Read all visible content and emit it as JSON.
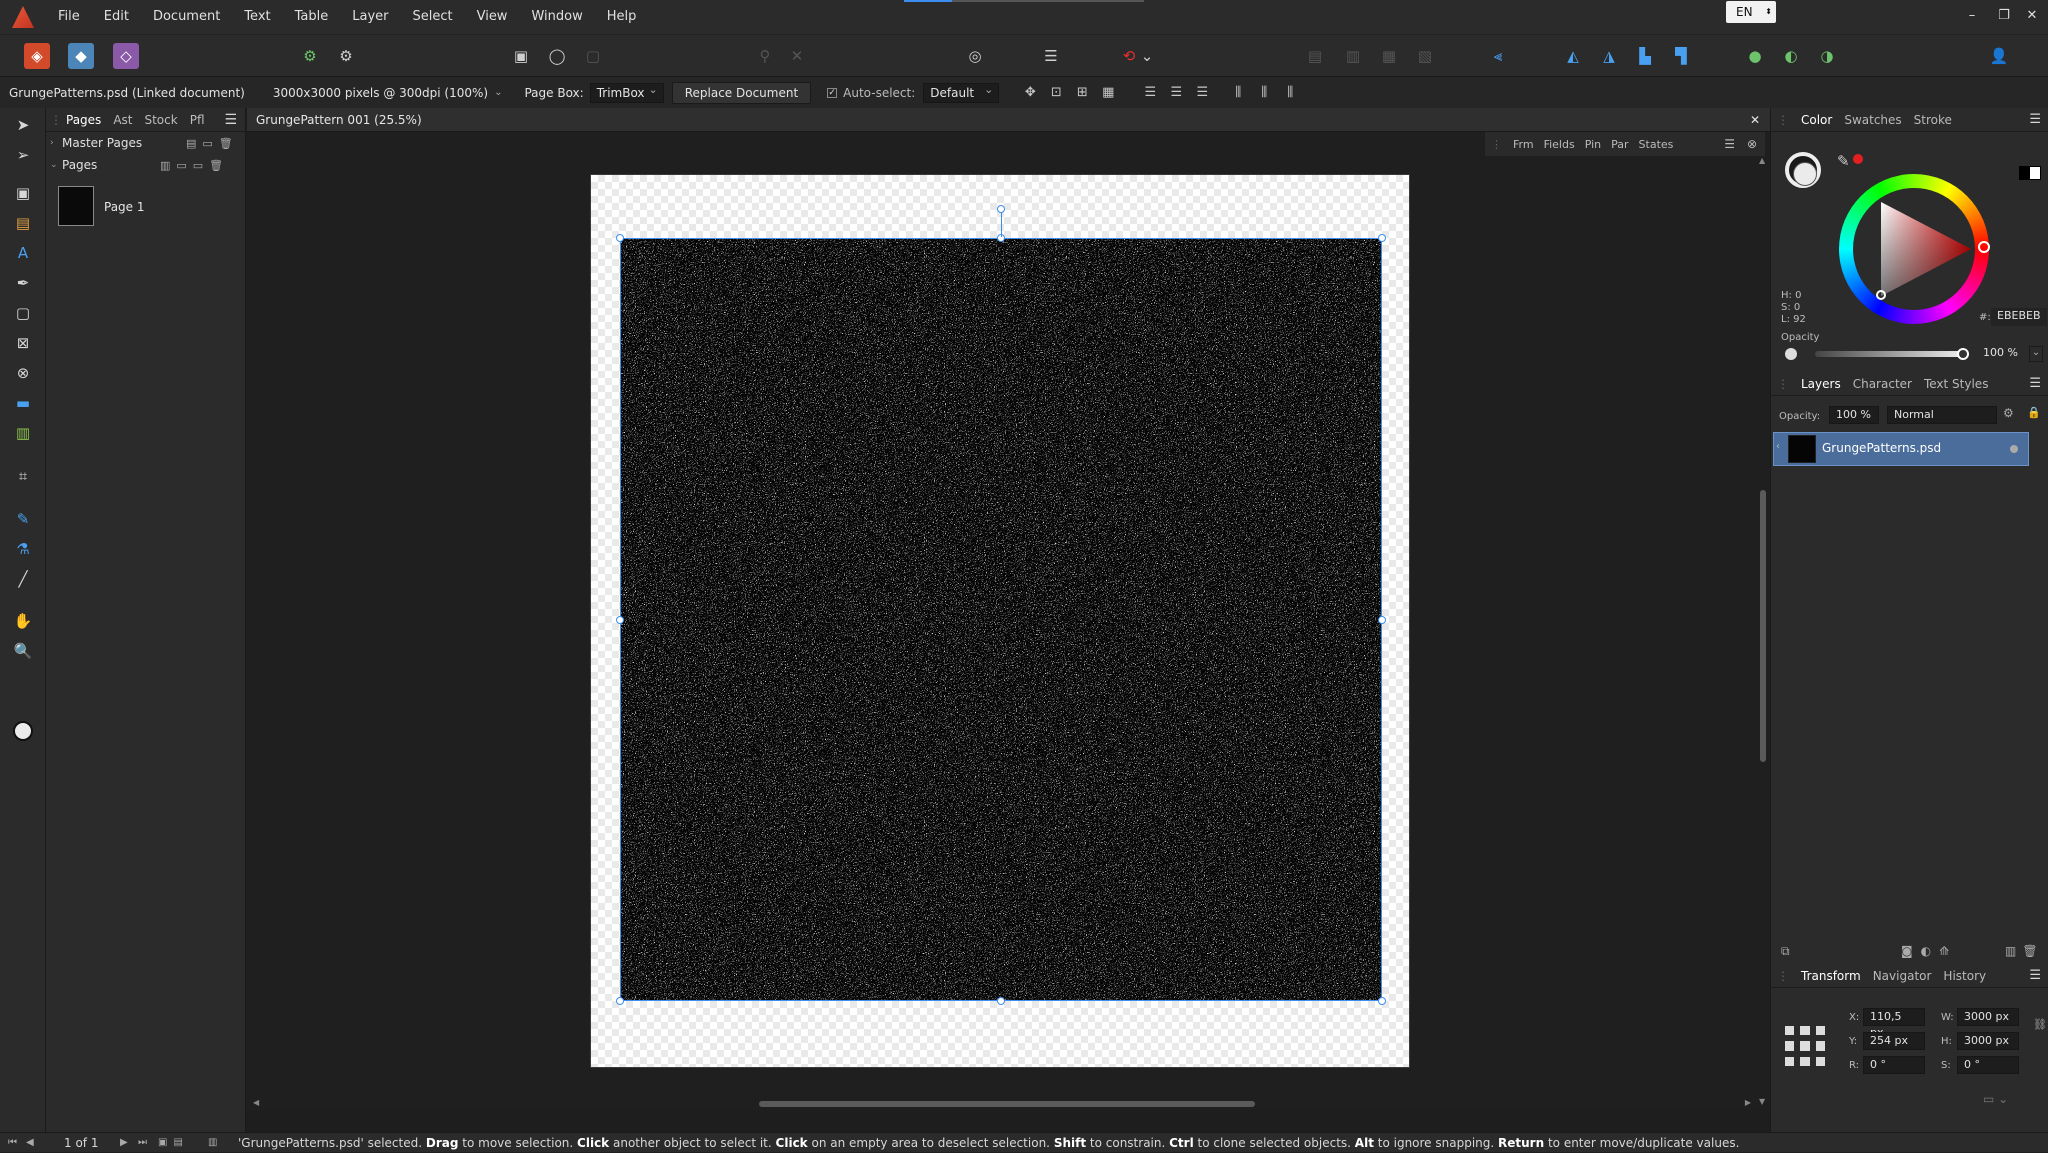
{
  "menubar": {
    "items": [
      "File",
      "Edit",
      "Document",
      "Text",
      "Table",
      "Layer",
      "Select",
      "View",
      "Window",
      "Help"
    ],
    "language": "EN"
  },
  "context": {
    "doc_name": "GrungePatterns.psd (Linked document)",
    "doc_info": "3000x3000 pixels @ 300dpi (100%)",
    "page_box_label": "Page Box:",
    "page_box_value": "TrimBox",
    "replace_button": "Replace Document",
    "auto_select_label": "Auto-select:",
    "auto_select_value": "Default"
  },
  "pages_panel": {
    "tabs": [
      "Pages",
      "Ast",
      "Stock",
      "Pfl"
    ],
    "master_pages": "Master Pages",
    "pages": "Pages",
    "page_name": "Page 1"
  },
  "document": {
    "tab_title": "GrungePattern 001 (25.5%)",
    "studio_tabs": [
      "Frm",
      "Fields",
      "Pin",
      "Par",
      "States"
    ]
  },
  "color_panel": {
    "tabs": [
      "Color",
      "Swatches",
      "Stroke"
    ],
    "h": "H: 0",
    "s": "S: 0",
    "l": "L: 92",
    "hex_label": "#:",
    "hex_value": "EBEBEB",
    "opacity_label": "Opacity",
    "opacity_value": "100 %",
    "accent": "#e32020"
  },
  "layers_panel": {
    "tabs": [
      "Layers",
      "Character",
      "Text Styles"
    ],
    "opacity_label": "Opacity:",
    "opacity_value": "100 %",
    "blend_mode": "Normal",
    "layer_name": "GrungePatterns.psd"
  },
  "transform_panel": {
    "tabs": [
      "Transform",
      "Navigator",
      "History"
    ],
    "x_label": "X:",
    "x_value": "110,5 px",
    "y_label": "Y:",
    "y_value": "254 px",
    "w_label": "W:",
    "w_value": "3000 px",
    "h_label": "H:",
    "h_value": "3000 px",
    "r_label": "R:",
    "r_value": "0 °",
    "s_label": "S:",
    "s_value": "0 °"
  },
  "status": {
    "page_counter": "1 of 1",
    "msg_1": "'GrungePatterns.psd' selected. ",
    "msg_drag": "Drag",
    "msg_2": " to move selection. ",
    "msg_click": "Click",
    "msg_3": " another object to select it. ",
    "msg_click2": "Click",
    "msg_4": " on an empty area to deselect selection. ",
    "msg_shift": "Shift",
    "msg_5": " to constrain. ",
    "msg_ctrl": "Ctrl",
    "msg_6": " to clone selected objects. ",
    "msg_alt": "Alt",
    "msg_7": " to ignore snapping. ",
    "msg_return": "Return",
    "msg_8": " to enter move/duplicate values."
  }
}
